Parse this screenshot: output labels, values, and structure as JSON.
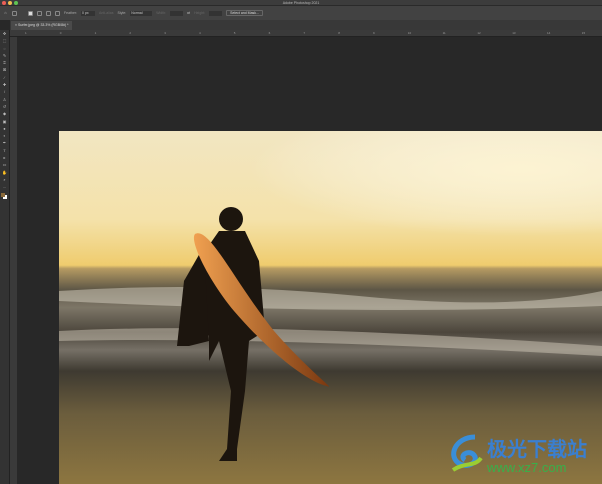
{
  "window": {
    "title": "Adobe Photoshop 2021"
  },
  "options": {
    "feather_label": "Feather:",
    "feather_value": "0 px",
    "antialias_label": "Anti-alias",
    "style_label": "Style:",
    "style_value": "Normal",
    "width_label": "Width:",
    "height_label": "Height:",
    "select_mask_label": "Select and Mask..."
  },
  "tab": {
    "close": "×",
    "label": "Surfer.jpeg @ 33.3% (RGB/8#) *"
  },
  "ruler": [
    "1",
    "0",
    "1",
    "2",
    "3",
    "4",
    "5",
    "6",
    "7",
    "8",
    "9",
    "10",
    "11",
    "12",
    "13",
    "14",
    "15"
  ],
  "tools": [
    "move",
    "marquee",
    "lasso",
    "quick-select",
    "crop",
    "frame",
    "eyedropper",
    "healing",
    "brush",
    "stamp",
    "history-brush",
    "eraser",
    "gradient",
    "blur",
    "dodge",
    "pen",
    "type",
    "path-select",
    "rectangle",
    "hand",
    "zoom",
    "more"
  ],
  "watermark": {
    "name": "极光下载站",
    "url": "www.xz7.com"
  },
  "colors": {
    "foreground": "#8a6a3a",
    "background": "#ffffff",
    "accent": "#3a7fd0"
  }
}
